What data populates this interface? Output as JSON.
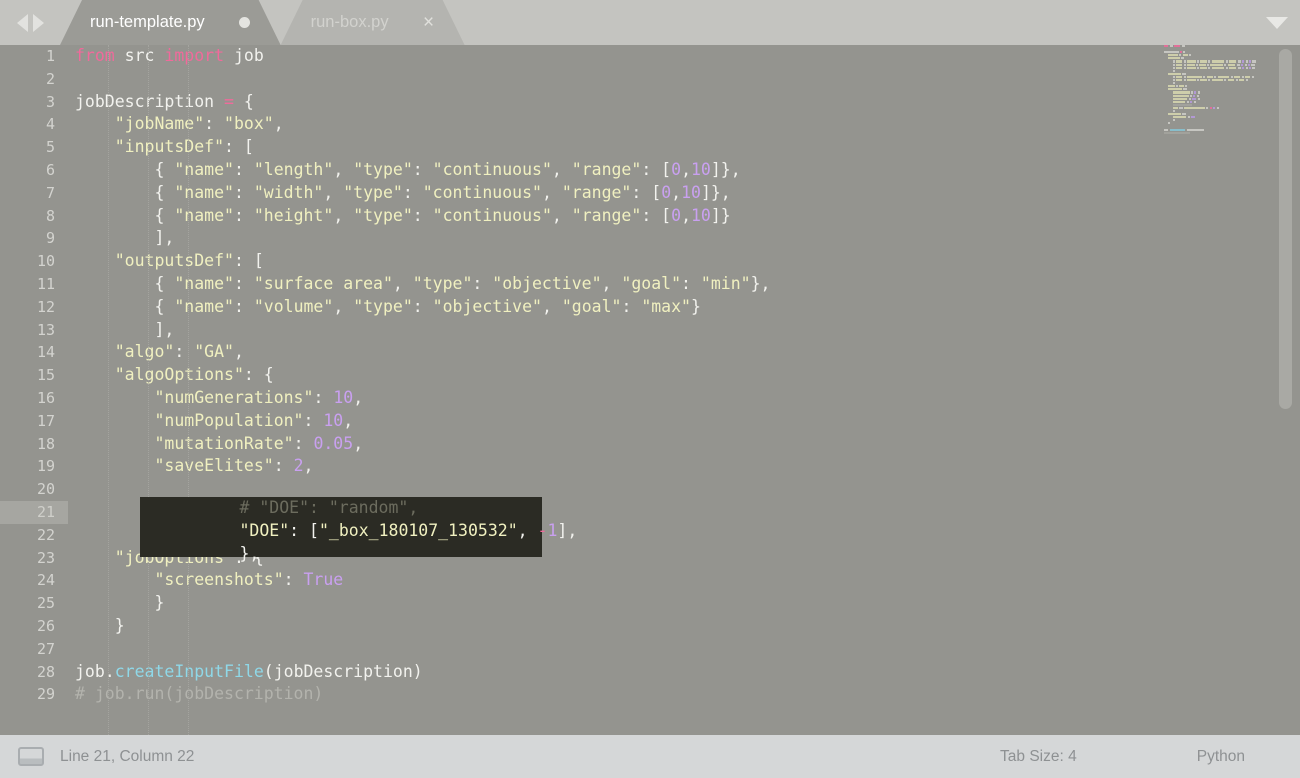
{
  "window": {
    "app": "text-editor",
    "colors": {
      "tabbar_bg": "#c4c4c0",
      "editor_bg": "#94948f",
      "active_tab_bg": "#9b9b96",
      "inactive_tab_bg": "#b4b4b0",
      "statusbar_bg": "#d5d7d8",
      "highlight_bg": "#2b2b24",
      "keyword": "#f06a9b",
      "string": "#f0f0c0",
      "number": "#c9a0f0",
      "comment": "#b3b3ad",
      "function": "#8fd8e8"
    }
  },
  "tabbar": {
    "nav_prev_icon": "arrow-left-icon",
    "nav_next_icon": "arrow-right-icon",
    "menu_icon": "chevron-down-icon",
    "tabs": [
      {
        "label": "run-template.py",
        "active": true,
        "dirty": true,
        "marker": "●"
      },
      {
        "label": "run-box.py",
        "active": false,
        "dirty": false,
        "marker": "×"
      }
    ]
  },
  "editor": {
    "language": "Python",
    "line_numbers": [
      1,
      2,
      3,
      4,
      5,
      6,
      7,
      8,
      9,
      10,
      11,
      12,
      13,
      14,
      15,
      16,
      17,
      18,
      19,
      20,
      21,
      22,
      23,
      24,
      25,
      26,
      27,
      28,
      29
    ],
    "current_line": 21,
    "lines": [
      {
        "n": 1,
        "tokens": [
          {
            "t": "from",
            "c": "kw"
          },
          {
            "t": " src ",
            "c": "pl"
          },
          {
            "t": "import",
            "c": "kw"
          },
          {
            "t": " job",
            "c": "pl"
          }
        ]
      },
      {
        "n": 2,
        "tokens": []
      },
      {
        "n": 3,
        "tokens": [
          {
            "t": "jobDescription ",
            "c": "pl"
          },
          {
            "t": "=",
            "c": "kw"
          },
          {
            "t": " {",
            "c": "pl"
          }
        ]
      },
      {
        "n": 4,
        "tokens": [
          {
            "t": "    ",
            "c": "pl"
          },
          {
            "t": "\"jobName\"",
            "c": "str"
          },
          {
            "t": ": ",
            "c": "pl"
          },
          {
            "t": "\"box\"",
            "c": "str"
          },
          {
            "t": ",",
            "c": "pl"
          }
        ]
      },
      {
        "n": 5,
        "tokens": [
          {
            "t": "    ",
            "c": "pl"
          },
          {
            "t": "\"inputsDef\"",
            "c": "str"
          },
          {
            "t": ": [",
            "c": "pl"
          }
        ]
      },
      {
        "n": 6,
        "tokens": [
          {
            "t": "        { ",
            "c": "pl"
          },
          {
            "t": "\"name\"",
            "c": "str"
          },
          {
            "t": ": ",
            "c": "pl"
          },
          {
            "t": "\"length\"",
            "c": "str"
          },
          {
            "t": ", ",
            "c": "pl"
          },
          {
            "t": "\"type\"",
            "c": "str"
          },
          {
            "t": ": ",
            "c": "pl"
          },
          {
            "t": "\"continuous\"",
            "c": "str"
          },
          {
            "t": ", ",
            "c": "pl"
          },
          {
            "t": "\"range\"",
            "c": "str"
          },
          {
            "t": ": [",
            "c": "pl"
          },
          {
            "t": "0",
            "c": "num"
          },
          {
            "t": ",",
            "c": "pl"
          },
          {
            "t": "10",
            "c": "num"
          },
          {
            "t": "]},",
            "c": "pl"
          }
        ]
      },
      {
        "n": 7,
        "tokens": [
          {
            "t": "        { ",
            "c": "pl"
          },
          {
            "t": "\"name\"",
            "c": "str"
          },
          {
            "t": ": ",
            "c": "pl"
          },
          {
            "t": "\"width\"",
            "c": "str"
          },
          {
            "t": ", ",
            "c": "pl"
          },
          {
            "t": "\"type\"",
            "c": "str"
          },
          {
            "t": ": ",
            "c": "pl"
          },
          {
            "t": "\"continuous\"",
            "c": "str"
          },
          {
            "t": ", ",
            "c": "pl"
          },
          {
            "t": "\"range\"",
            "c": "str"
          },
          {
            "t": ": [",
            "c": "pl"
          },
          {
            "t": "0",
            "c": "num"
          },
          {
            "t": ",",
            "c": "pl"
          },
          {
            "t": "10",
            "c": "num"
          },
          {
            "t": "]},",
            "c": "pl"
          }
        ]
      },
      {
        "n": 8,
        "tokens": [
          {
            "t": "        { ",
            "c": "pl"
          },
          {
            "t": "\"name\"",
            "c": "str"
          },
          {
            "t": ": ",
            "c": "pl"
          },
          {
            "t": "\"height\"",
            "c": "str"
          },
          {
            "t": ", ",
            "c": "pl"
          },
          {
            "t": "\"type\"",
            "c": "str"
          },
          {
            "t": ": ",
            "c": "pl"
          },
          {
            "t": "\"continuous\"",
            "c": "str"
          },
          {
            "t": ", ",
            "c": "pl"
          },
          {
            "t": "\"range\"",
            "c": "str"
          },
          {
            "t": ": [",
            "c": "pl"
          },
          {
            "t": "0",
            "c": "num"
          },
          {
            "t": ",",
            "c": "pl"
          },
          {
            "t": "10",
            "c": "num"
          },
          {
            "t": "]}",
            "c": "pl"
          }
        ]
      },
      {
        "n": 9,
        "tokens": [
          {
            "t": "        ],",
            "c": "pl"
          }
        ]
      },
      {
        "n": 10,
        "tokens": [
          {
            "t": "    ",
            "c": "pl"
          },
          {
            "t": "\"outputsDef\"",
            "c": "str"
          },
          {
            "t": ": [",
            "c": "pl"
          }
        ]
      },
      {
        "n": 11,
        "tokens": [
          {
            "t": "        { ",
            "c": "pl"
          },
          {
            "t": "\"name\"",
            "c": "str"
          },
          {
            "t": ": ",
            "c": "pl"
          },
          {
            "t": "\"surface area\"",
            "c": "str"
          },
          {
            "t": ", ",
            "c": "pl"
          },
          {
            "t": "\"type\"",
            "c": "str"
          },
          {
            "t": ": ",
            "c": "pl"
          },
          {
            "t": "\"objective\"",
            "c": "str"
          },
          {
            "t": ", ",
            "c": "pl"
          },
          {
            "t": "\"goal\"",
            "c": "str"
          },
          {
            "t": ": ",
            "c": "pl"
          },
          {
            "t": "\"min\"",
            "c": "str"
          },
          {
            "t": "},",
            "c": "pl"
          }
        ]
      },
      {
        "n": 12,
        "tokens": [
          {
            "t": "        { ",
            "c": "pl"
          },
          {
            "t": "\"name\"",
            "c": "str"
          },
          {
            "t": ": ",
            "c": "pl"
          },
          {
            "t": "\"volume\"",
            "c": "str"
          },
          {
            "t": ", ",
            "c": "pl"
          },
          {
            "t": "\"type\"",
            "c": "str"
          },
          {
            "t": ": ",
            "c": "pl"
          },
          {
            "t": "\"objective\"",
            "c": "str"
          },
          {
            "t": ", ",
            "c": "pl"
          },
          {
            "t": "\"goal\"",
            "c": "str"
          },
          {
            "t": ": ",
            "c": "pl"
          },
          {
            "t": "\"max\"",
            "c": "str"
          },
          {
            "t": "}",
            "c": "pl"
          }
        ]
      },
      {
        "n": 13,
        "tokens": [
          {
            "t": "        ],",
            "c": "pl"
          }
        ]
      },
      {
        "n": 14,
        "tokens": [
          {
            "t": "    ",
            "c": "pl"
          },
          {
            "t": "\"algo\"",
            "c": "str"
          },
          {
            "t": ": ",
            "c": "pl"
          },
          {
            "t": "\"GA\"",
            "c": "str"
          },
          {
            "t": ",",
            "c": "pl"
          }
        ]
      },
      {
        "n": 15,
        "tokens": [
          {
            "t": "    ",
            "c": "pl"
          },
          {
            "t": "\"algoOptions\"",
            "c": "str"
          },
          {
            "t": ": {",
            "c": "pl"
          }
        ]
      },
      {
        "n": 16,
        "tokens": [
          {
            "t": "        ",
            "c": "pl"
          },
          {
            "t": "\"numGenerations\"",
            "c": "str"
          },
          {
            "t": ": ",
            "c": "pl"
          },
          {
            "t": "10",
            "c": "num"
          },
          {
            "t": ",",
            "c": "pl"
          }
        ]
      },
      {
        "n": 17,
        "tokens": [
          {
            "t": "        ",
            "c": "pl"
          },
          {
            "t": "\"numPopulation\"",
            "c": "str"
          },
          {
            "t": ": ",
            "c": "pl"
          },
          {
            "t": "10",
            "c": "num"
          },
          {
            "t": ",",
            "c": "pl"
          }
        ]
      },
      {
        "n": 18,
        "tokens": [
          {
            "t": "        ",
            "c": "pl"
          },
          {
            "t": "\"mutationRate\"",
            "c": "str"
          },
          {
            "t": ": ",
            "c": "pl"
          },
          {
            "t": "0.05",
            "c": "num"
          },
          {
            "t": ",",
            "c": "pl"
          }
        ]
      },
      {
        "n": 19,
        "tokens": [
          {
            "t": "        ",
            "c": "pl"
          },
          {
            "t": "\"saveElites\"",
            "c": "str"
          },
          {
            "t": ": ",
            "c": "pl"
          },
          {
            "t": "2",
            "c": "num"
          },
          {
            "t": ",",
            "c": "pl"
          }
        ]
      },
      {
        "n": 20,
        "tokens": [
          {
            "t": "        # \"DOE\": \"random\",",
            "c": "com"
          }
        ],
        "highlighted": true
      },
      {
        "n": 21,
        "tokens": [
          {
            "t": "        ",
            "c": "pl"
          },
          {
            "t": "\"DOE\"",
            "c": "str"
          },
          {
            "t": ": [",
            "c": "pl"
          },
          {
            "t": "\"_box_180107_130532\"",
            "c": "str"
          },
          {
            "t": ", ",
            "c": "pl"
          },
          {
            "t": "-",
            "c": "kw"
          },
          {
            "t": "1",
            "c": "num"
          },
          {
            "t": "],",
            "c": "pl"
          }
        ],
        "highlighted": true
      },
      {
        "n": 22,
        "tokens": [
          {
            "t": "        },",
            "c": "pl"
          }
        ],
        "highlighted": true
      },
      {
        "n": 23,
        "tokens": [
          {
            "t": "    ",
            "c": "pl"
          },
          {
            "t": "\"jobOptions\"",
            "c": "str"
          },
          {
            "t": ": {",
            "c": "pl"
          }
        ]
      },
      {
        "n": 24,
        "tokens": [
          {
            "t": "        ",
            "c": "pl"
          },
          {
            "t": "\"screenshots\"",
            "c": "str"
          },
          {
            "t": ": ",
            "c": "pl"
          },
          {
            "t": "True",
            "c": "num"
          }
        ]
      },
      {
        "n": 25,
        "tokens": [
          {
            "t": "        }",
            "c": "pl"
          }
        ]
      },
      {
        "n": 26,
        "tokens": [
          {
            "t": "    }",
            "c": "pl"
          }
        ]
      },
      {
        "n": 27,
        "tokens": []
      },
      {
        "n": 28,
        "tokens": [
          {
            "t": "job.",
            "c": "pl"
          },
          {
            "t": "createInputFile",
            "c": "fn"
          },
          {
            "t": "(jobDescription)",
            "c": "pl"
          }
        ]
      },
      {
        "n": 29,
        "tokens": [
          {
            "t": "# job.run(jobDescription)",
            "c": "com"
          }
        ]
      }
    ]
  },
  "minimap": {
    "name": "code-minimap"
  },
  "scrollbar": {
    "name": "vertical-scrollbar"
  },
  "statusbar": {
    "console_icon": "console-panel-icon",
    "position": "Line 21, Column 22",
    "tab_size": "Tab Size: 4",
    "language": "Python"
  }
}
